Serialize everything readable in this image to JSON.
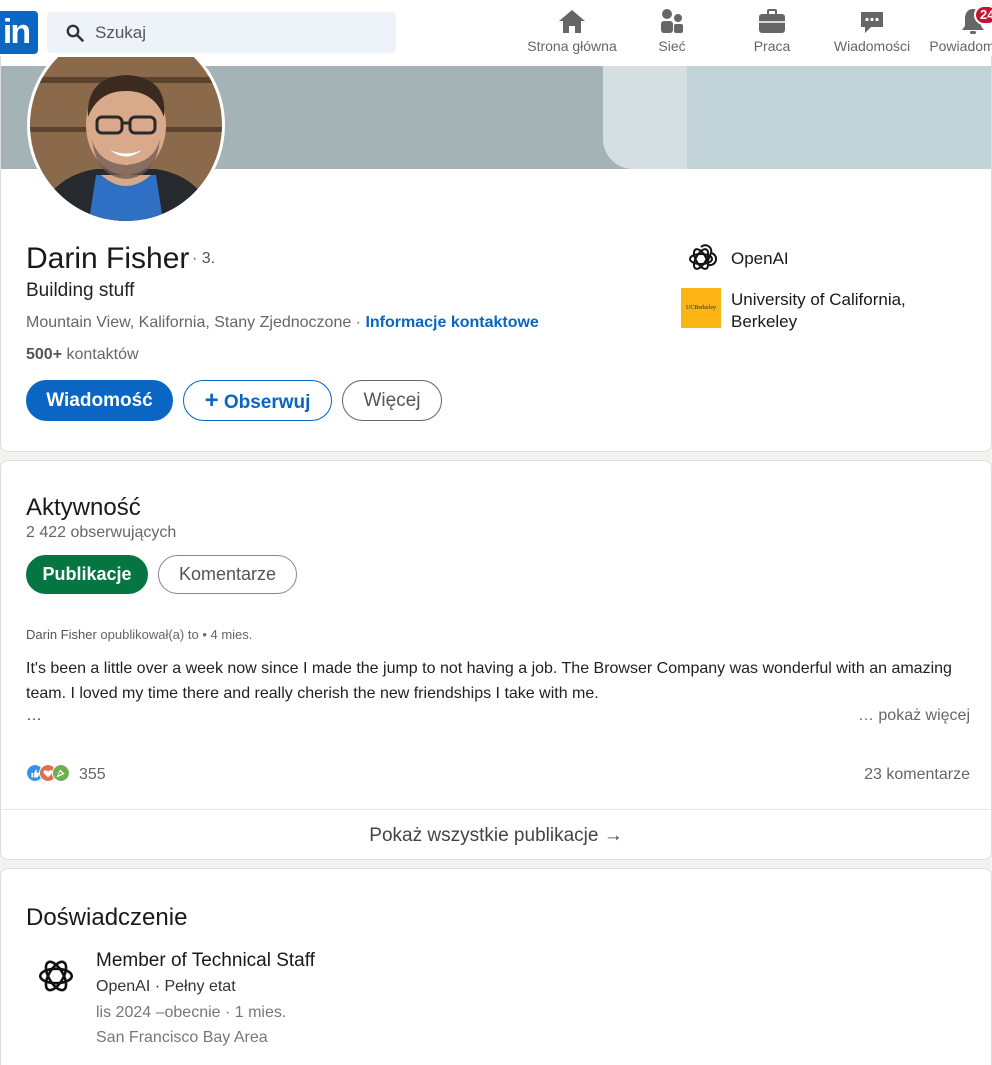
{
  "nav": {
    "logo_text": "in",
    "search_placeholder": "Szukaj",
    "items": [
      {
        "label": "Strona główna",
        "icon": "home-icon"
      },
      {
        "label": "Sieć",
        "icon": "network-icon"
      },
      {
        "label": "Praca",
        "icon": "briefcase-icon"
      },
      {
        "label": "Wiadomości",
        "icon": "messaging-icon"
      },
      {
        "label": "Powiadom",
        "icon": "bell-icon"
      }
    ],
    "notifications_badge": "24",
    "accent_color": "#0a66c2",
    "badge_color": "#cb112d"
  },
  "profile": {
    "name": "Darin Fisher",
    "degree": "· 3.",
    "headline": "Building stuff",
    "location": "Mountain View, Kalifornia, Stany Zjednoczone",
    "location_sep": " · ",
    "contact_info_link": "Informacje kontaktowe",
    "connections_count": "500+",
    "connections_label": "kontaktów",
    "buttons": {
      "message": "Wiadomość",
      "follow_plus": "+",
      "follow": "Obserwuj",
      "more": "Więcej"
    },
    "orgs": [
      {
        "name": "OpenAI",
        "icon": "openai-logo-icon"
      },
      {
        "name_line1": "University of California,",
        "name_line2": "Berkeley",
        "icon": "uc-berkeley-logo-icon",
        "logo_text": "UCBerkeley"
      }
    ]
  },
  "activity": {
    "title": "Aktywność",
    "followers": "2 422 obserwujących",
    "tabs": [
      "Publikacje",
      "Komentarze"
    ],
    "active_tab_color": "#057642",
    "post": {
      "author": "Darin Fisher",
      "action": "opublikował(a) to",
      "time": "• 4 mies.",
      "text": "It's been a little over a week now since I made the jump to not having a job. The Browser Company was wonderful with an amazing team. I loved my time there and really cherish the new friendships I take with me.",
      "ellipsis": "…",
      "show_more": "… pokaż więcej",
      "reactions_count": "355",
      "comments": "23 komentarze"
    },
    "show_all": "Pokaż wszystkie publikacje →"
  },
  "experience": {
    "title": "Doświadczenie",
    "items": [
      {
        "role": "Member of Technical Staff",
        "company": "OpenAI · Pełny etat",
        "dates": "lis 2024 –obecnie · 1 mies.",
        "location": "San Francisco Bay Area"
      }
    ]
  }
}
